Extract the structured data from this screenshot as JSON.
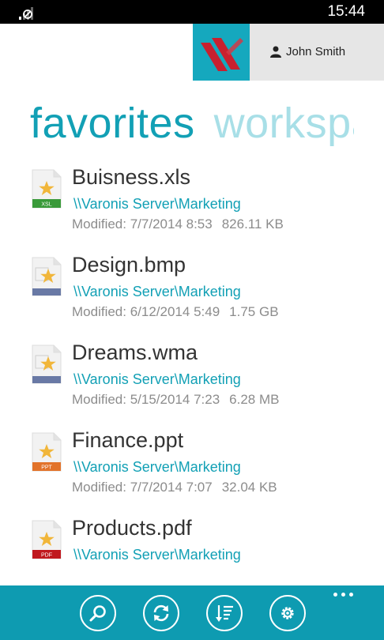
{
  "status_bar": {
    "time": "15:44",
    "icons": [
      "signal-icon",
      "wifi-off-icon"
    ]
  },
  "account": {
    "user_name": "John Smith",
    "logo_icon": "varonis-logo-icon",
    "user_icon": "person-icon"
  },
  "pivot": {
    "tabs": [
      {
        "label": "favorites",
        "selected": true
      },
      {
        "label": "workspaces",
        "selected": false
      }
    ]
  },
  "files": [
    {
      "name": "Buisness.xls",
      "path": "\\\\Varonis Server\\Marketing",
      "modified_label": "Modified:",
      "modified": "7/7/2014 8:53",
      "size": "826.11 KB",
      "type_badge": "XSL",
      "badge_color": "#3a9a3a",
      "icon": "excel-file-favorite-icon"
    },
    {
      "name": "Design.bmp",
      "path": "\\\\Varonis Server\\Marketing",
      "modified_label": "Modified:",
      "modified": "6/12/2014 5:49",
      "size": "1.75 GB",
      "type_badge": "",
      "badge_color": "#6979a5",
      "icon": "image-file-favorite-icon"
    },
    {
      "name": "Dreams.wma",
      "path": "\\\\Varonis Server\\Marketing",
      "modified_label": "Modified:",
      "modified": "5/15/2014 7:23",
      "size": "6.28 MB",
      "type_badge": "",
      "badge_color": "#6979a5",
      "icon": "audio-file-favorite-icon"
    },
    {
      "name": "Finance.ppt",
      "path": "\\\\Varonis Server\\Marketing",
      "modified_label": "Modified:",
      "modified": "7/7/2014 7:07",
      "size": "32.04 KB",
      "type_badge": "PPT",
      "badge_color": "#e2732a",
      "icon": "powerpoint-file-favorite-icon"
    },
    {
      "name": "Products.pdf",
      "path": "\\\\Varonis Server\\Marketing",
      "modified_label": "",
      "modified": "",
      "size": "",
      "type_badge": "PDF",
      "badge_color": "#c0181e",
      "icon": "pdf-file-favorite-icon"
    }
  ],
  "app_bar": {
    "buttons": [
      {
        "name": "search-button",
        "icon": "search-icon"
      },
      {
        "name": "refresh-button",
        "icon": "refresh-icon"
      },
      {
        "name": "sort-button",
        "icon": "sort-icon"
      },
      {
        "name": "settings-button",
        "icon": "gear-icon"
      }
    ],
    "more_icon": "more-icon"
  },
  "colors": {
    "accent": "#12a0b5",
    "app_bar": "#0e9bb1",
    "inactive_tab": "#a8dfe7",
    "meta_text": "#8c8c8c"
  }
}
